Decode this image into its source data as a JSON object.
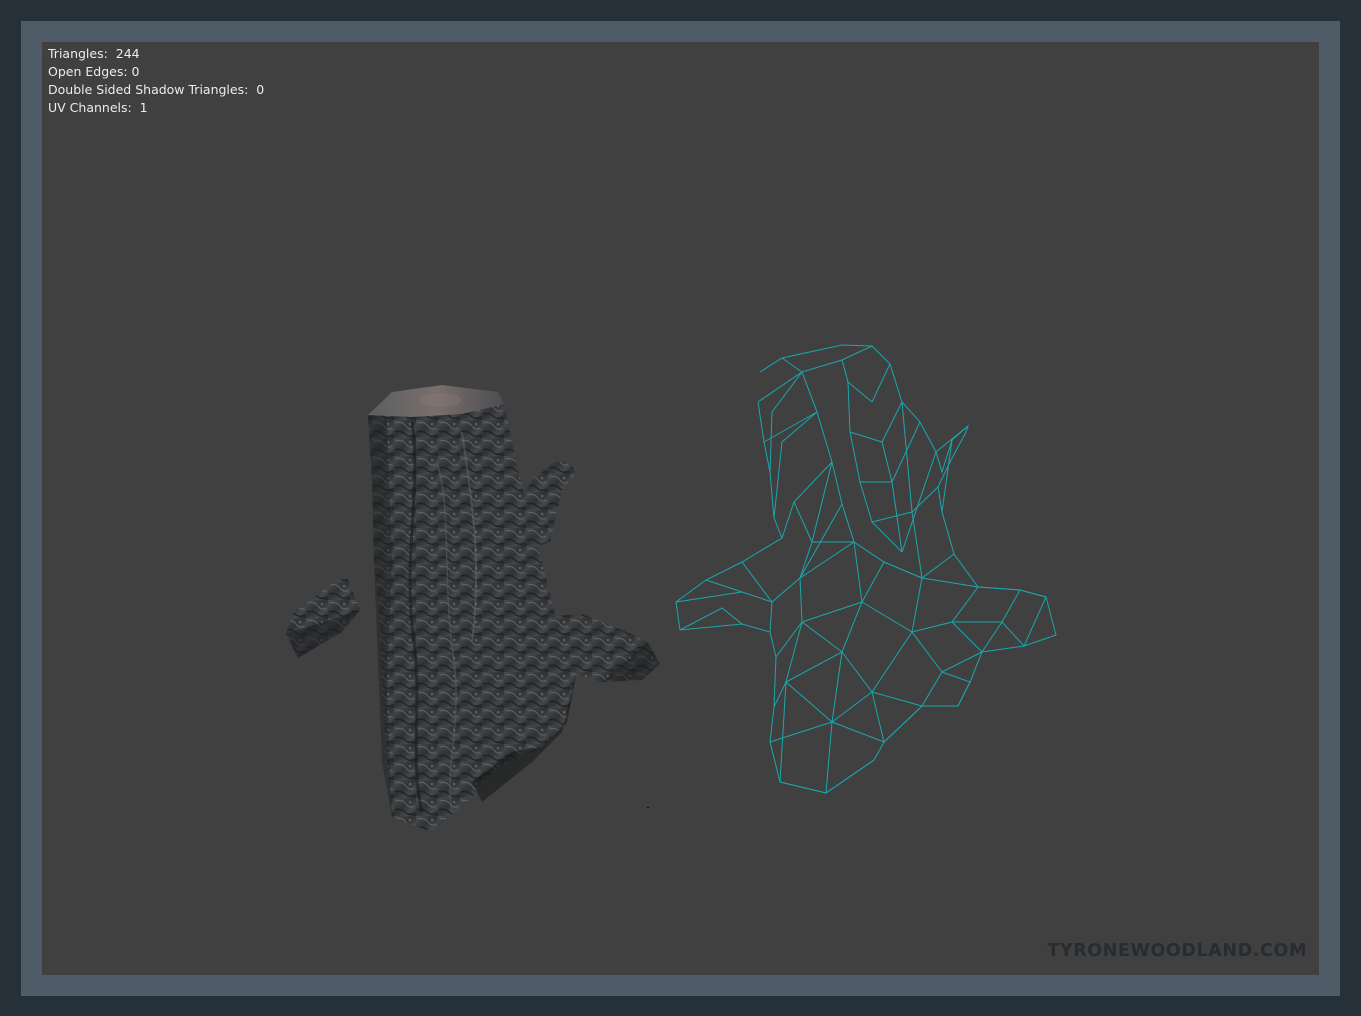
{
  "stats": [
    {
      "label": "Triangles:",
      "value": "244"
    },
    {
      "label": "Open Edges:",
      "value": "0"
    },
    {
      "label": "Double Sided Shadow Triangles:",
      "value": "0"
    },
    {
      "label": "UV Channels:",
      "value": "1"
    }
  ],
  "watermark": "TYRONEWOODLAND.COM",
  "colors": {
    "frame": "#4f5b66",
    "background": "#263039",
    "viewport": "#404040",
    "wireframe": "#1aa7ac",
    "bark": "#3a3c3e"
  },
  "icons": [
    "textured-tree-stump-model",
    "wireframe-tree-stump-model"
  ]
}
